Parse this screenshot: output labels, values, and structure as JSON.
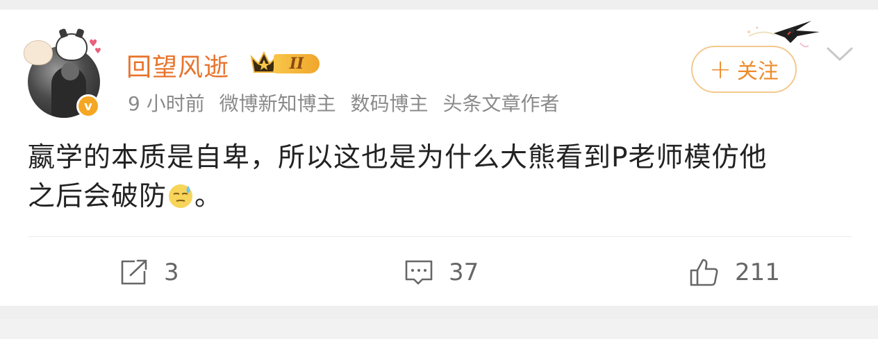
{
  "post": {
    "author": {
      "name": "回望风逝",
      "vip_level": "II",
      "verified_badge": "v"
    },
    "meta": {
      "time": "9 小时前",
      "tag1": "微博新知博主",
      "tag2": "数码博主",
      "tag3": "头条文章作者"
    },
    "follow_label": "关注",
    "follow_plus": "+",
    "content": {
      "line1": "嬴学的本质是自卑，所以这也是为什么大熊看到P老师模仿他",
      "line2": "之后会破防",
      "emoji": "sweat-face-emoji",
      "end": "。"
    },
    "actions": {
      "repost_count": "3",
      "comment_count": "37",
      "like_count": "211"
    }
  },
  "colors": {
    "username": "#e8742c",
    "follow_text": "#ee8a2a",
    "follow_border": "#f3c98f",
    "meta_text": "#8a8a8a",
    "body_text": "#222222",
    "action_text": "#666666",
    "vip_gold": "#f8c64a",
    "verify_badge": "#f5a623"
  },
  "icons": {
    "repost": "repost-icon",
    "comment": "comment-icon",
    "like": "thumbs-up-icon",
    "more": "chevron-down-icon",
    "decoration": "swallow-icon"
  }
}
